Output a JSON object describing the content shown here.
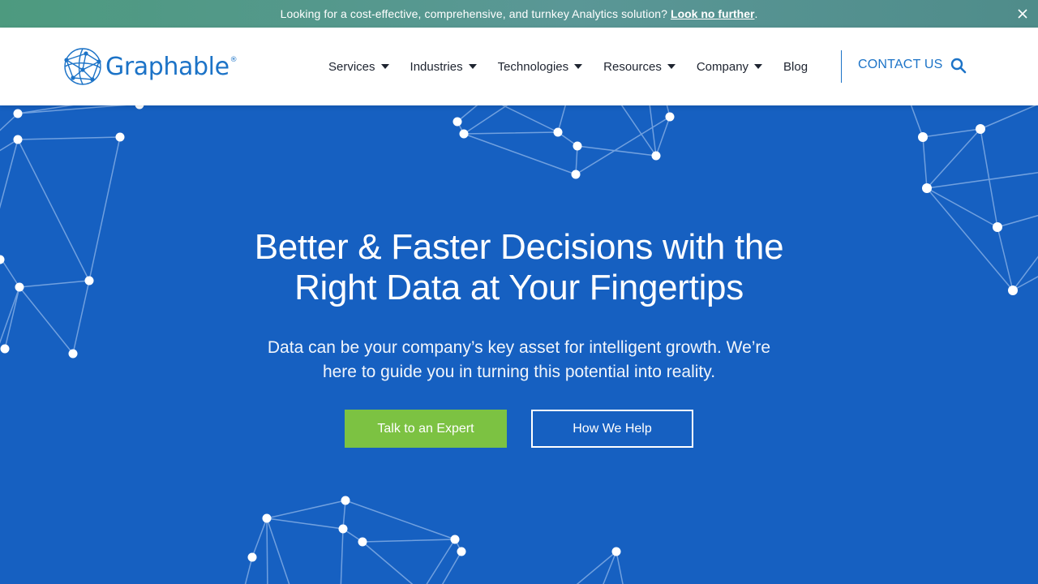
{
  "announcement": {
    "message": "Looking for a cost-effective, comprehensive, and turnkey Analytics solution?",
    "link": "Look no further",
    "suffix": ".",
    "close_icon": "close-icon"
  },
  "header": {
    "logo_text": "Graphable",
    "logo_mark": "®",
    "nav": [
      {
        "label": "Services"
      },
      {
        "label": "Industries"
      },
      {
        "label": "Technologies"
      },
      {
        "label": "Resources"
      },
      {
        "label": "Company"
      },
      {
        "label": "Blog"
      }
    ],
    "contact_label": "CONTACT US",
    "search_icon": "search-icon"
  },
  "hero": {
    "title_line1": "Better & Faster Decisions with the",
    "title_line2": "Right Data at Your Fingertips",
    "subtitle_line1": "Data can be your company’s key asset for intelligent growth. We’re",
    "subtitle_line2": "here to guide you in turning this potential into reality.",
    "primary_cta": "Talk to an Expert",
    "secondary_cta": "How We Help"
  },
  "colors": {
    "announce_bar": "#4f968a",
    "brand_blue": "#1c73c7",
    "hero_bg": "#1660c1",
    "cta_green": "#7cc242"
  }
}
